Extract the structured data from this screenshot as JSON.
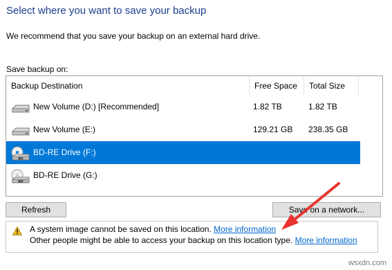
{
  "header": {
    "title": "Select where you want to save your backup",
    "recommendation": "We recommend that you save your backup on an external hard drive.",
    "save_on_label": "Save backup on:"
  },
  "destinations": {
    "columns": [
      "Backup Destination",
      "Free Space",
      "Total Size"
    ],
    "rows": [
      {
        "name": "New Volume (D:) [Recommended]",
        "free": "1.82 TB",
        "total": "1.82 TB",
        "icon": "hard-drive-icon",
        "selected": false
      },
      {
        "name": "New Volume (E:)",
        "free": "129.21 GB",
        "total": "238.35 GB",
        "icon": "hard-drive-icon",
        "selected": false
      },
      {
        "name": "BD-RE Drive (F:)",
        "free": "",
        "total": "",
        "icon": "bd-drive-icon",
        "icon_text": "BD",
        "selected": true
      },
      {
        "name": "BD-RE Drive (G:)",
        "free": "",
        "total": "",
        "icon": "bd-drive-icon",
        "icon_text": "BD",
        "selected": false
      }
    ]
  },
  "buttons": {
    "refresh": "Refresh",
    "network": "Save on a network..."
  },
  "info": {
    "line1": "A system image cannot be saved on this location.",
    "line1_link": "More information",
    "line2": "Other people might be able to access your backup on this location type.",
    "line2_link": "More information"
  },
  "watermark": "wsxdn.com",
  "colors": {
    "title": "#1a3e8c",
    "selection": "#0078d7",
    "link": "#0066cc",
    "annotation_arrow": "#e8332e",
    "warning": "#f5c518"
  }
}
